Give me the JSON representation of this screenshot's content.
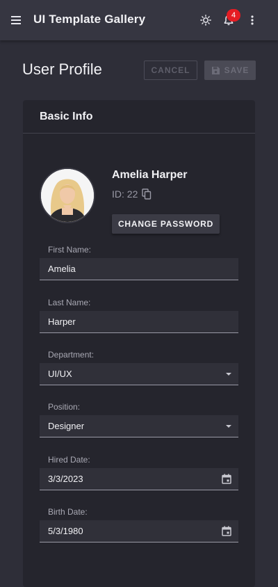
{
  "app": {
    "title": "UI Template Gallery",
    "notification_count": "4"
  },
  "page": {
    "title": "User Profile",
    "cancel_label": "CANCEL",
    "save_label": "SAVE"
  },
  "card": {
    "title": "Basic Info",
    "full_name": "Amelia Harper",
    "id_text": "ID: 22",
    "change_password_label": "CHANGE PASSWORD"
  },
  "fields": {
    "first_name": {
      "label": "First Name:",
      "value": "Amelia"
    },
    "last_name": {
      "label": "Last Name:",
      "value": "Harper"
    },
    "department": {
      "label": "Department:",
      "value": "UI/UX"
    },
    "position": {
      "label": "Position:",
      "value": "Designer"
    },
    "hired_date": {
      "label": "Hired Date:",
      "value": "3/3/2023"
    },
    "birth_date": {
      "label": "Birth Date:",
      "value": "5/3/1980"
    }
  },
  "icons": {
    "menu": "menu-icon",
    "theme": "sun-icon",
    "notifications": "bell-icon",
    "more": "more-vert-icon",
    "save": "floppy-disk-icon",
    "copy": "copy-icon",
    "calendar": "calendar-icon",
    "dropdown": "chevron-down-icon"
  },
  "colors": {
    "background": "#2e2e38",
    "appbar": "#363641",
    "card": "#25252d",
    "badge": "#e51c23"
  }
}
